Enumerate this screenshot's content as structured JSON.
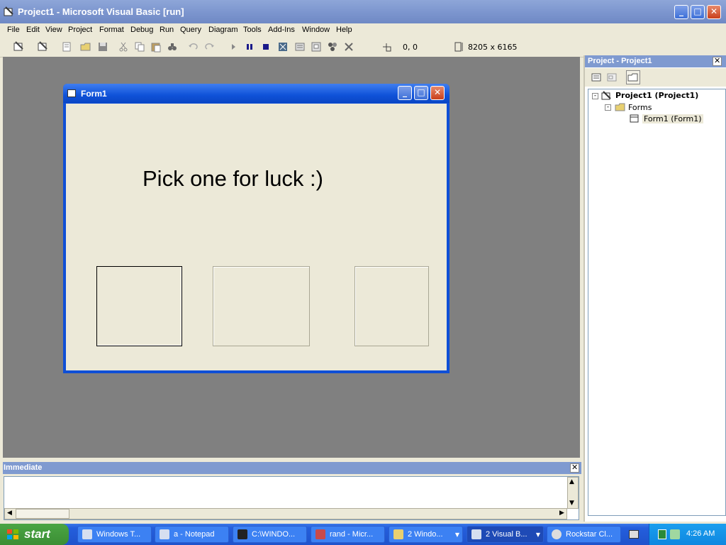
{
  "window": {
    "title": "Project1 - Microsoft Visual Basic [run]"
  },
  "menu": [
    "File",
    "Edit",
    "View",
    "Project",
    "Format",
    "Debug",
    "Run",
    "Query",
    "Diagram",
    "Tools",
    "Add-Ins",
    "Window",
    "Help"
  ],
  "toolbar": {
    "position": "0, 0",
    "size": "8205 x 6165"
  },
  "form": {
    "title": "Form1",
    "caption": "Pick one for luck :)"
  },
  "project_pane": {
    "title": "Project - Project1",
    "tree": {
      "root": "Project1 (Project1)",
      "folder": "Forms",
      "item": "Form1 (Form1)"
    }
  },
  "immediate": {
    "title": "Immediate"
  },
  "taskbar": {
    "start_label": "start",
    "tasks": [
      "Windows T...",
      "a - Notepad",
      "C:\\WINDO...",
      "rand - Micr...",
      "2 Windo...",
      "2 Visual B...",
      "Rockstar Cl..."
    ],
    "clock": "4:26 AM"
  },
  "colors": {
    "title_active": "#0f52d9",
    "title_inactive": "#7f9ad0",
    "mdi_bg": "#808080",
    "face": "#ece9d8"
  }
}
